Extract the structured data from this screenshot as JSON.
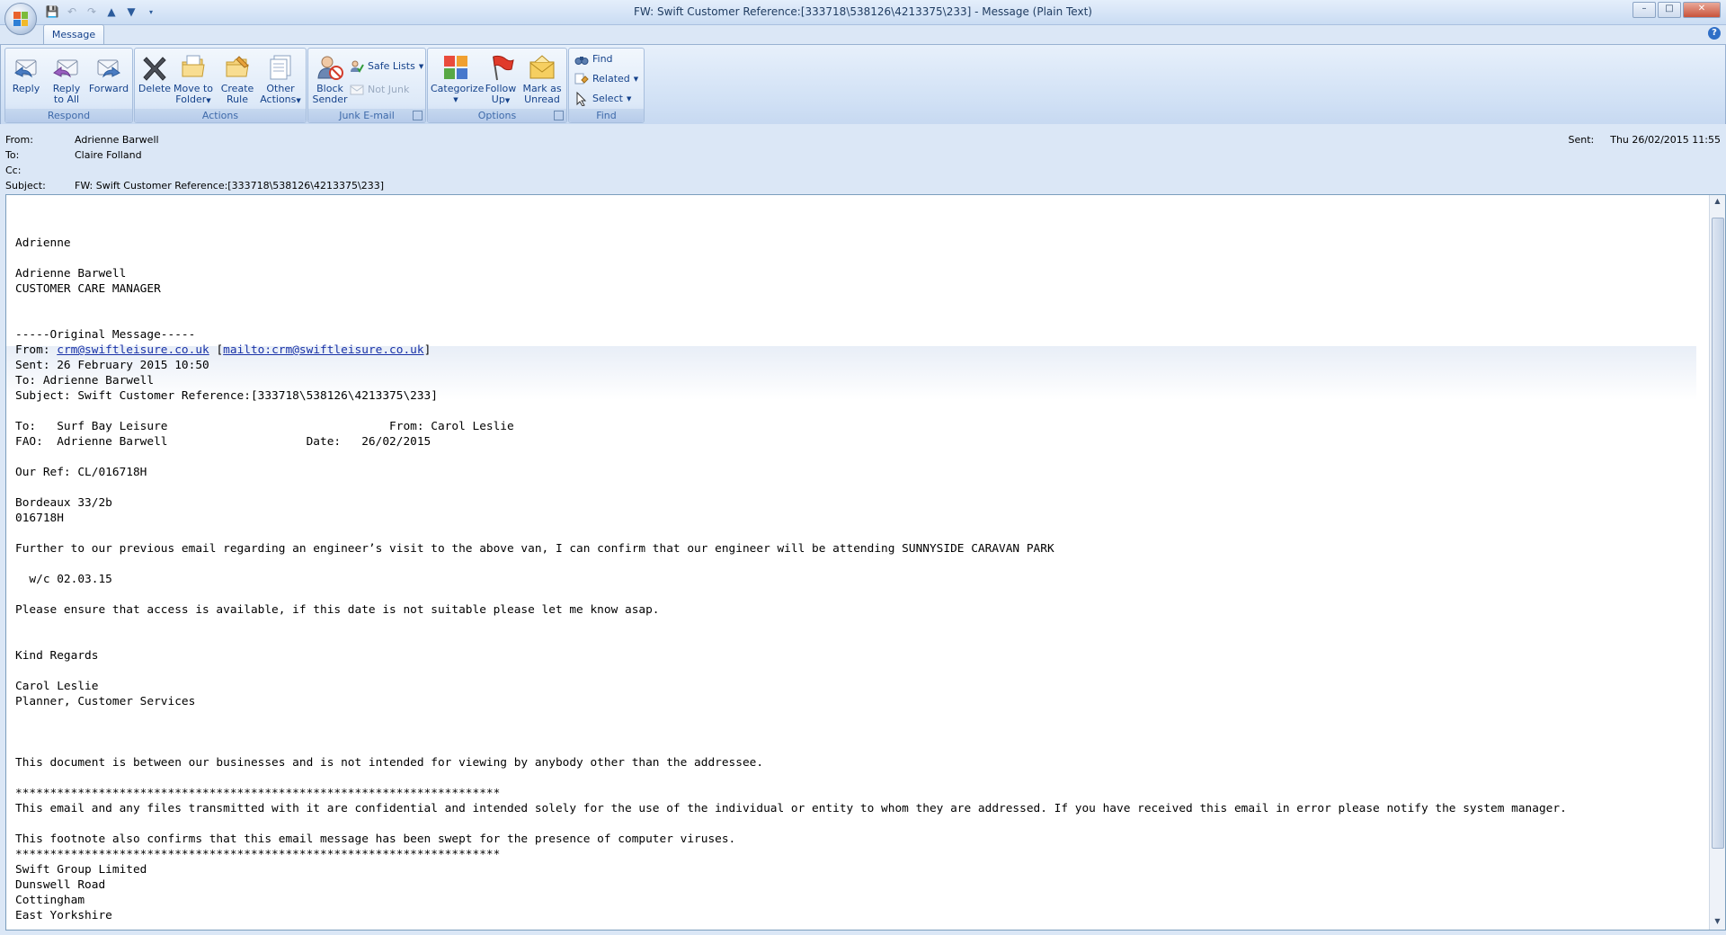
{
  "window": {
    "title": "FW: Swift Customer Reference:[333718\\538126\\4213375\\233] - Message (Plain Text)",
    "controls": [
      "–",
      "□",
      "✕"
    ]
  },
  "tabs": [
    {
      "label": "Message"
    }
  ],
  "ribbon": {
    "groups": {
      "respond": "Respond",
      "actions": "Actions",
      "junk": "Junk E-mail",
      "options": "Options",
      "find": "Find"
    },
    "buttons": {
      "reply": "Reply",
      "reply_all_1": "Reply",
      "reply_all_2": "to All",
      "forward": "Forward",
      "delete": "Delete",
      "move_1": "Move to",
      "move_2": "Folder",
      "create_1": "Create",
      "create_2": "Rule",
      "other_1": "Other",
      "other_2": "Actions",
      "block_1": "Block",
      "block_2": "Sender",
      "safe_lists": "Safe Lists",
      "not_junk": "Not Junk",
      "categorize": "Categorize",
      "follow_1": "Follow",
      "follow_2": "Up",
      "mark_1": "Mark as",
      "mark_2": "Unread",
      "find": "Find",
      "related": "Related",
      "select": "Select"
    }
  },
  "header": {
    "from_label": "From:",
    "from": "Adrienne Barwell",
    "to_label": "To:",
    "to": "Claire Folland",
    "cc_label": "Cc:",
    "cc": "",
    "subject_label": "Subject:",
    "subject": "FW: Swift Customer Reference:[333718\\538126\\4213375\\233]",
    "sent_label": "Sent:",
    "sent": "Thu 26/02/2015 11:55"
  },
  "body": {
    "l01": "Adrienne",
    "l02": "Adrienne Barwell",
    "l03": "CUSTOMER CARE MANAGER",
    "l04": "-----Original Message-----",
    "l05_pre": "From: ",
    "l05_link1": "crm@swiftleisure.co.uk",
    "l05_mid": " [",
    "l05_link2": "mailto:crm@swiftleisure.co.uk",
    "l05_post": "]",
    "l06": "Sent: 26 February 2015 10:50",
    "l07": "To: Adrienne Barwell",
    "l08": "Subject: Swift Customer Reference:[333718\\538126\\4213375\\233]",
    "l09": "To:   Surf Bay Leisure                                From: Carol Leslie",
    "l10": "FAO:  Adrienne Barwell                    Date:   26/02/2015",
    "l11": "Our Ref: CL/016718H",
    "l12": "Bordeaux 33/2b",
    "l13": "016718H",
    "l14": "Further to our previous email regarding an engineer’s visit to the above van, I can confirm that our engineer will be attending SUNNYSIDE CARAVAN PARK",
    "l15": "  w/c 02.03.15",
    "l16": "Please ensure that access is available, if this date is not suitable please let me know asap.",
    "l17": "Kind Regards",
    "l18": "Carol Leslie",
    "l19": "Planner, Customer Services",
    "l20": "This document is between our businesses and is not intended for viewing by anybody other than the addressee.",
    "l21": "**********************************************************************",
    "l22": "This email and any files transmitted with it are confidential and intended solely for the use of the individual or entity to whom they are addressed. If you have received this email in error please notify the system manager.",
    "l23": "This footnote also confirms that this email message has been swept for the presence of computer viruses.",
    "l24": "**********************************************************************",
    "l25": "Swift Group Limited",
    "l26": "Dunswell Road",
    "l27": "Cottingham",
    "l28": "East Yorkshire"
  }
}
